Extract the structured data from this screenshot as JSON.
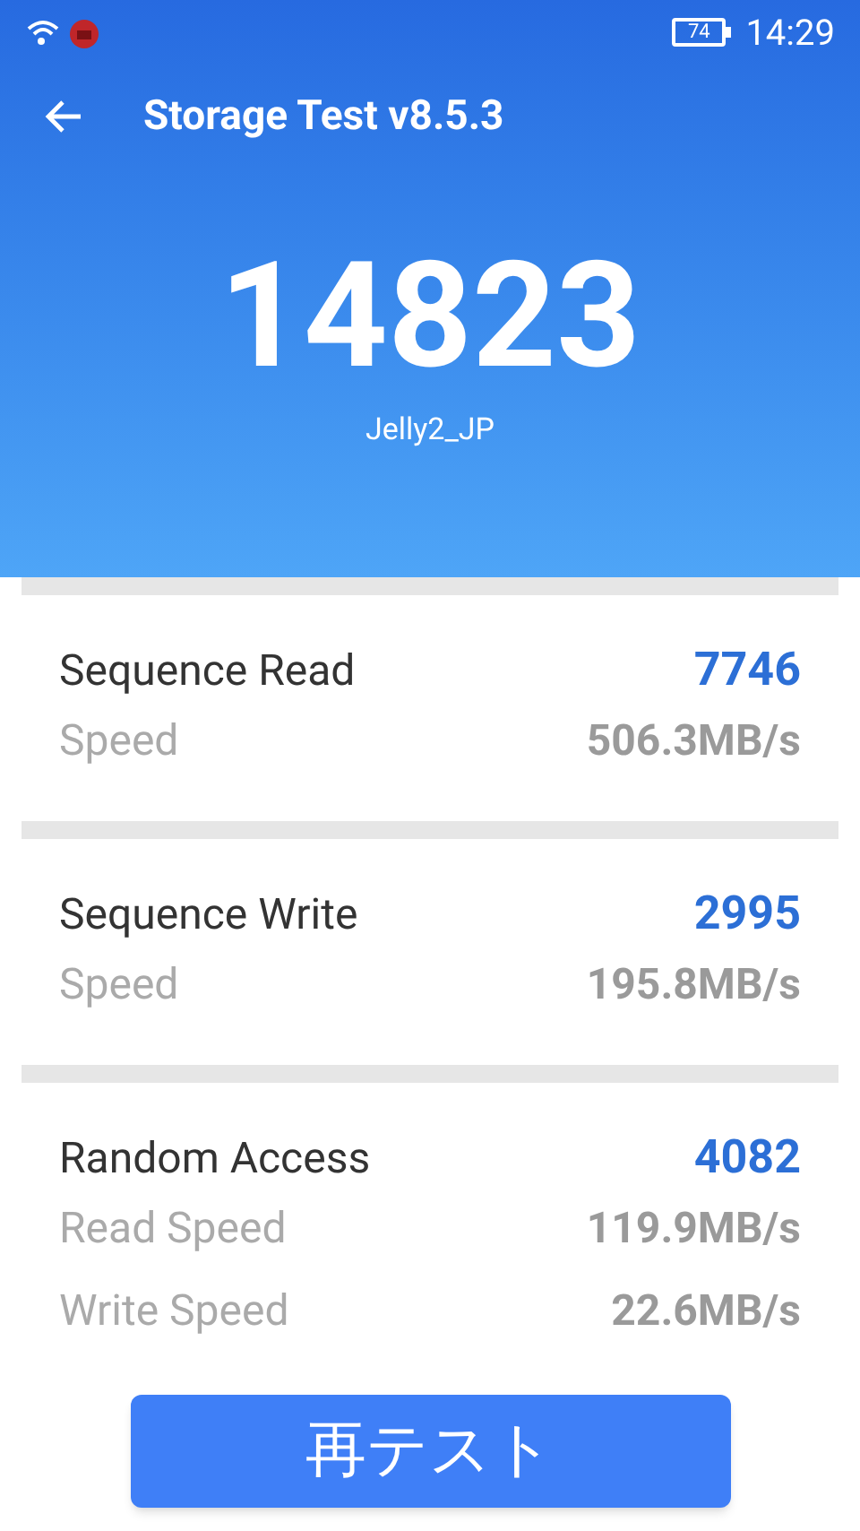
{
  "status_bar": {
    "battery": "74",
    "time": "14:29"
  },
  "title": "Storage Test v8.5.3",
  "score": "14823",
  "device": "Jelly2_JP",
  "sections": [
    {
      "title": "Sequence Read",
      "score": "7746",
      "rows": [
        {
          "label": "Speed",
          "value": "506.3MB/s"
        }
      ]
    },
    {
      "title": "Sequence Write",
      "score": "2995",
      "rows": [
        {
          "label": "Speed",
          "value": "195.8MB/s"
        }
      ]
    },
    {
      "title": "Random Access",
      "score": "4082",
      "rows": [
        {
          "label": "Read Speed",
          "value": "119.9MB/s"
        },
        {
          "label": "Write Speed",
          "value": "22.6MB/s"
        }
      ]
    }
  ],
  "button": "再テスト"
}
